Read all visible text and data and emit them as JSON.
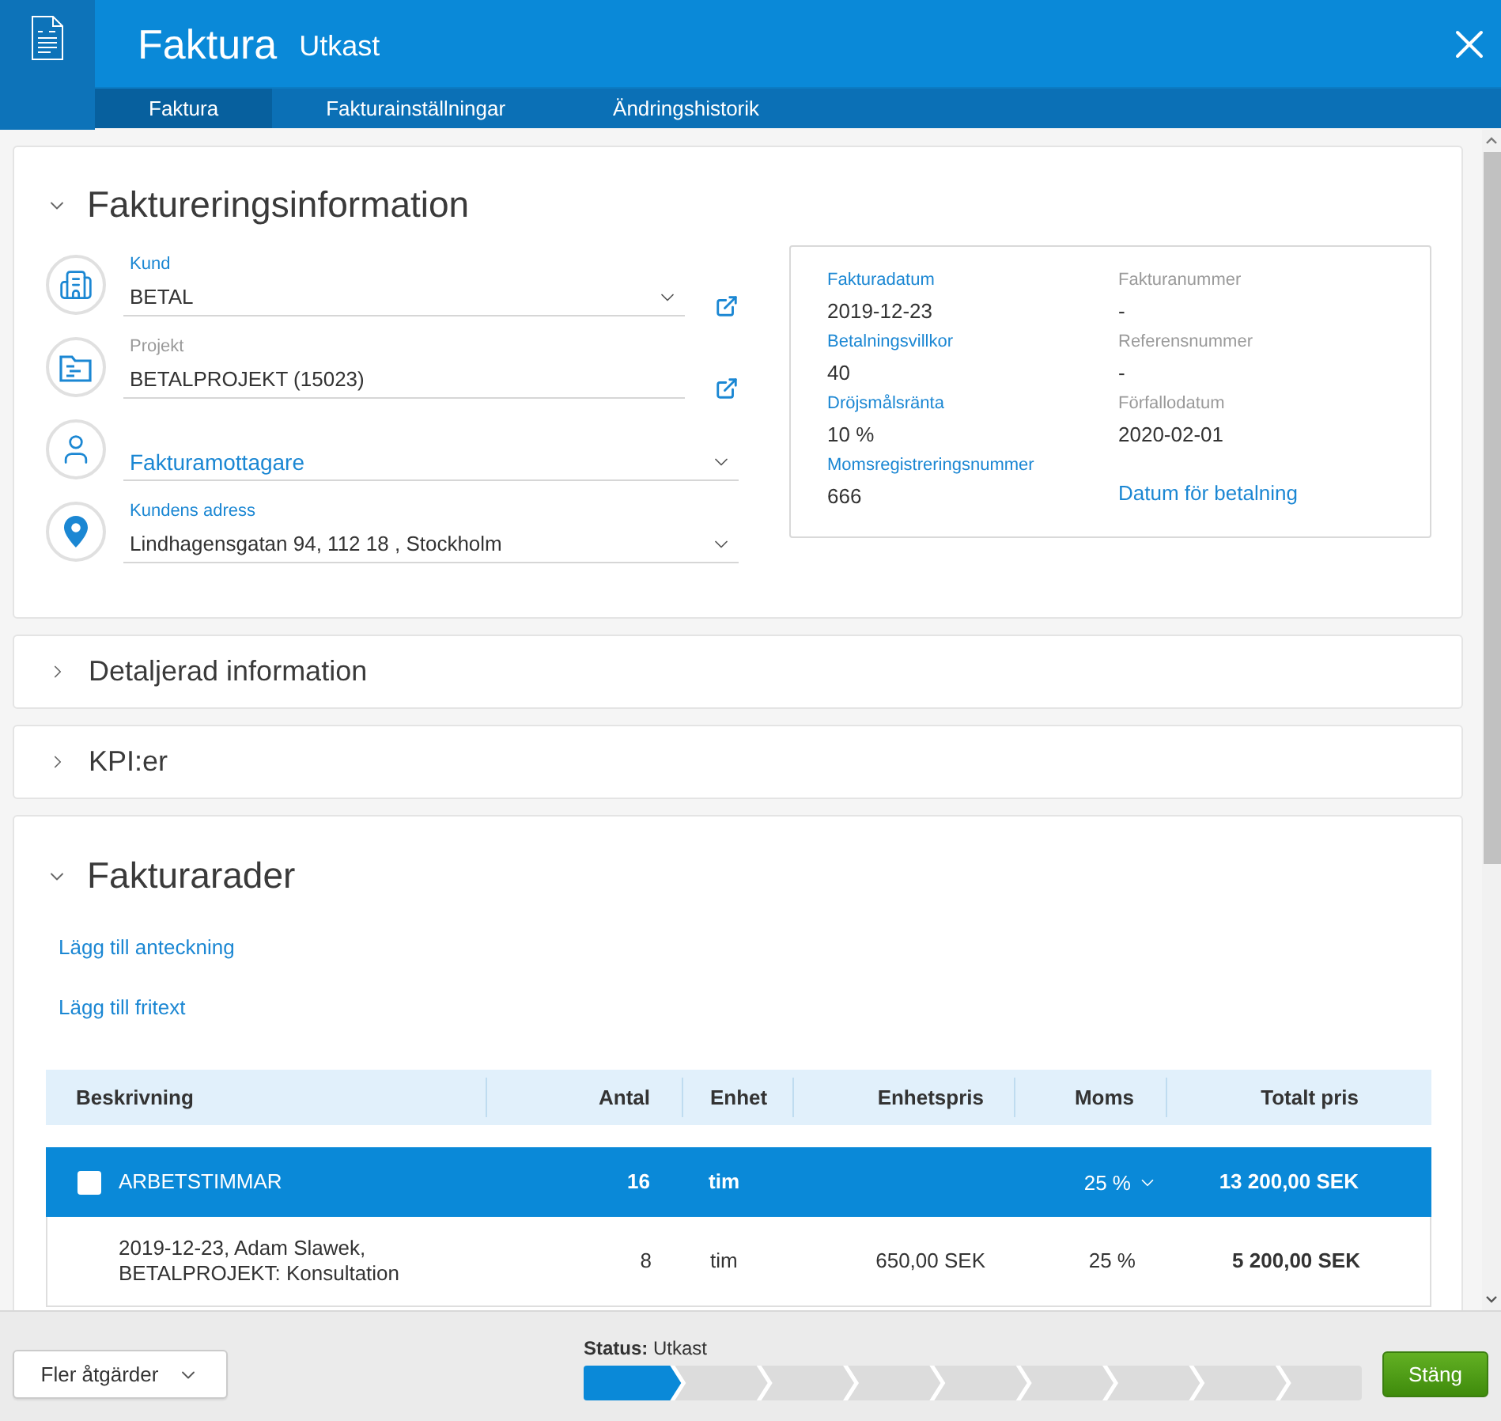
{
  "header": {
    "title": "Faktura",
    "status": "Utkast"
  },
  "tabs": [
    {
      "label": "Faktura",
      "selected": true
    },
    {
      "label": "Fakturainställningar",
      "selected": false
    },
    {
      "label": "Ändringshistorik",
      "selected": false
    }
  ],
  "billing": {
    "title": "Faktureringsinformation",
    "expanded": true,
    "fields": [
      {
        "label": "Kund",
        "value": "BETAL",
        "disabled": false,
        "external_link": true
      },
      {
        "label": "Projekt",
        "value": "BETALPROJEKT (15023)",
        "disabled": true,
        "external_link": true
      },
      {
        "placeholder": "Fakturamottagare",
        "disabled": false,
        "external_link": false
      },
      {
        "label": "Kundens adress",
        "value": "Lindhagensgatan 94, 112 18 , Stockholm",
        "disabled": false,
        "external_link": false
      }
    ],
    "summary": {
      "columns": [
        [
          {
            "label": "Fakturadatum",
            "value": "2019-12-23",
            "disabled": false
          },
          {
            "label": "Betalningsvillkor",
            "value": "40",
            "disabled": false
          },
          {
            "label": "Dröjsmålsränta",
            "value": "10 %",
            "disabled": false
          },
          {
            "label": "Momsregistreringsnummer",
            "value": "666",
            "disabled": false
          }
        ],
        [
          {
            "label": "Fakturanummer",
            "value": "-",
            "disabled": true
          },
          {
            "label": "Referensnummer",
            "value": "-",
            "disabled": true
          },
          {
            "label": "Förfallodatum",
            "value": "2020-02-01",
            "disabled": true
          }
        ]
      ],
      "payment_link": "Datum för betalning"
    }
  },
  "collapsed_sections": [
    {
      "title": "Detaljerad information",
      "expanded": false
    },
    {
      "title": "KPI:er",
      "expanded": false
    }
  ],
  "invoice_lines": {
    "title": "Fakturarader",
    "expanded": true,
    "links": [
      "Lägg till anteckning",
      "Lägg till fritext"
    ],
    "table": {
      "columns": [
        "Beskrivning",
        "Antal",
        "Enhet",
        "Enhetspris",
        "Moms",
        "Totalt pris"
      ],
      "rows": [
        {
          "kind": "group",
          "checked": false,
          "description": "ARBETSTIMMAR",
          "quantity": "16",
          "unit": "tim",
          "vat": "25 %",
          "total": "13 200,00 SEK"
        },
        {
          "kind": "item",
          "description": "2019-12-23, Adam Slawek, BETALPROJEKT: Konsultation",
          "quantity": "8",
          "unit": "tim",
          "unit_price": "650,00 SEK",
          "vat": "25 %",
          "total": "5 200,00 SEK"
        }
      ]
    }
  },
  "footer": {
    "more_actions": "Fler åtgärder",
    "status": "**Status:** Utkast",
    "steps": [
      {
        "selected": true
      },
      {
        "selected": false
      },
      {
        "selected": false
      },
      {
        "selected": false
      },
      {
        "selected": false
      },
      {
        "selected": false
      },
      {
        "selected": false
      },
      {
        "selected": false
      },
      {
        "selected": false
      }
    ],
    "close": "Stäng"
  }
}
